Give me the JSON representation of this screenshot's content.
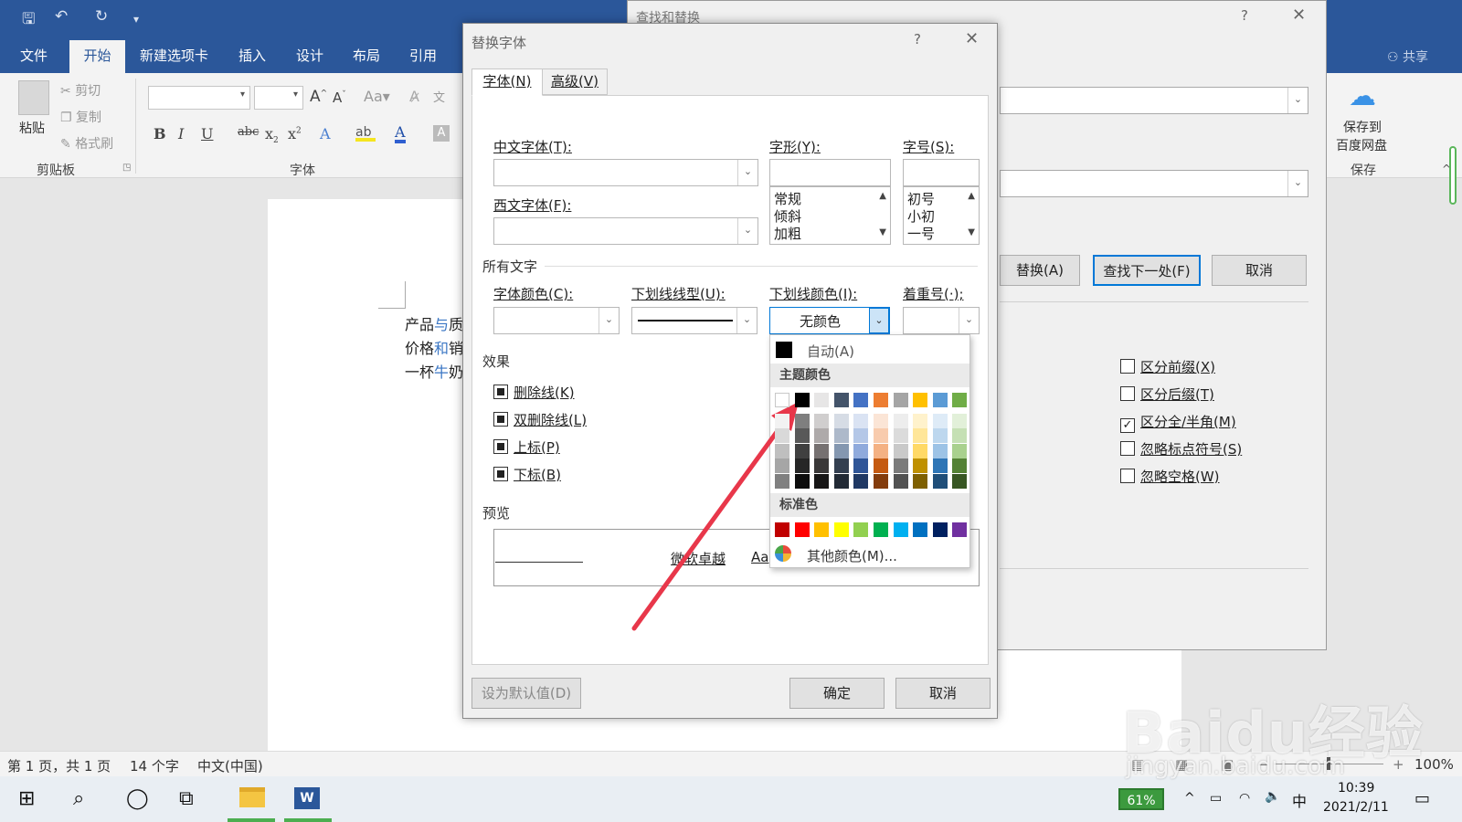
{
  "word": {
    "ribbon_tabs": [
      "文件",
      "开始",
      "新建选项卡",
      "插入",
      "设计",
      "布局",
      "引用"
    ],
    "share": "共享",
    "clipboard": {
      "paste": "粘贴",
      "cut": "剪切",
      "copy": "复制",
      "format_painter": "格式刷",
      "group": "剪贴板"
    },
    "font_group": "字体",
    "save_group": {
      "line1": "保存到",
      "line2": "百度网盘",
      "group": "保存"
    },
    "document_lines": [
      {
        "a": "产品",
        "b": "与",
        "c": "质"
      },
      {
        "a": "价格",
        "b": "和",
        "c": "销"
      },
      {
        "a": "一杯",
        "b": "牛",
        "c": "奶"
      }
    ],
    "status": {
      "page": "第 1 页，共 1 页",
      "words": "14 个字",
      "language": "中文(中国)",
      "zoom": "100%"
    }
  },
  "find_replace": {
    "title": "查找和替换",
    "help": "?",
    "buttons": {
      "replace": "替换(A)",
      "find_next": "查找下一处(F)",
      "cancel": "取消"
    },
    "options": [
      {
        "label": "区分前缀(X)",
        "checked": false
      },
      {
        "label": "区分后缀(T)",
        "checked": false
      },
      {
        "label": "区分全/半角(M)",
        "checked": true
      },
      {
        "label": "忽略标点符号(S)",
        "checked": false
      },
      {
        "label": "忽略空格(W)",
        "checked": false
      }
    ]
  },
  "font_dialog": {
    "title": "替换字体",
    "help": "?",
    "tabs": [
      "字体(N)",
      "高级(V)"
    ],
    "chinese_font_label": "中文字体(T):",
    "western_font_label": "西文字体(F):",
    "style_label": "字形(Y):",
    "style_options": [
      "常规",
      "倾斜",
      "加粗"
    ],
    "size_label": "字号(S):",
    "size_options": [
      "初号",
      "小初",
      "一号"
    ],
    "all_text": "所有文字",
    "font_color_label": "字体颜色(C):",
    "underline_style_label": "下划线线型(U):",
    "underline_color_label": "下划线颜色(I):",
    "underline_color_value": "无颜色",
    "emphasis_label": "着重号(·);",
    "effects_title": "效果",
    "effects": [
      "删除线(K)",
      "双删除线(L)",
      "上标(P)",
      "下标(B)"
    ],
    "preview_title": "预览",
    "preview_text": "微软卓越",
    "preview_text2": "Aa",
    "buttons": {
      "set_default": "设为默认值(D)",
      "ok": "确定",
      "cancel": "取消"
    }
  },
  "color_popup": {
    "auto": "自动(A)",
    "theme_header": "主题颜色",
    "theme_colors": [
      "#ffffff",
      "#000000",
      "#e7e6e6",
      "#44546a",
      "#4472c4",
      "#ed7d31",
      "#a5a5a5",
      "#ffc000",
      "#5b9bd5",
      "#70ad47"
    ],
    "theme_tints": [
      [
        "#f2f2f2",
        "#d9d9d9",
        "#bfbfbf",
        "#a6a6a6",
        "#808080"
      ],
      [
        "#7f7f7f",
        "#595959",
        "#404040",
        "#262626",
        "#0d0d0d"
      ],
      [
        "#d0cece",
        "#aeaaaa",
        "#767171",
        "#3a3838",
        "#171616"
      ],
      [
        "#d6dce5",
        "#adb9ca",
        "#8497b0",
        "#333f50",
        "#222a35"
      ],
      [
        "#dae3f3",
        "#b4c7e7",
        "#8faadc",
        "#2f5597",
        "#1f3864"
      ],
      [
        "#fbe5d6",
        "#f8cbad",
        "#f4b183",
        "#c55a11",
        "#843c0c"
      ],
      [
        "#ededed",
        "#dbdbdb",
        "#c9c9c9",
        "#7b7b7b",
        "#525252"
      ],
      [
        "#fff2cc",
        "#ffe699",
        "#ffd966",
        "#bf9000",
        "#7f6000"
      ],
      [
        "#deebf7",
        "#bdd7ee",
        "#9dc3e6",
        "#2e75b6",
        "#1f4e79"
      ],
      [
        "#e2f0d9",
        "#c5e0b4",
        "#a9d18e",
        "#548235",
        "#385723"
      ]
    ],
    "standard_header": "标准色",
    "standard_colors": [
      "#c00000",
      "#ff0000",
      "#ffc000",
      "#ffff00",
      "#92d050",
      "#00b050",
      "#00b0f0",
      "#0070c0",
      "#002060",
      "#7030a0"
    ],
    "more": "其他颜色(M)..."
  },
  "taskbar": {
    "battery": "61%",
    "ime": "中",
    "time": "10:39",
    "date": "2021/2/11"
  },
  "watermark": {
    "main": "Baidu经验",
    "sub": "jingyan.baidu.com"
  },
  "accent": {
    "word_blue": "#2b579a",
    "arrow_red": "#e8374a",
    "focus_blue": "#0078d7"
  }
}
